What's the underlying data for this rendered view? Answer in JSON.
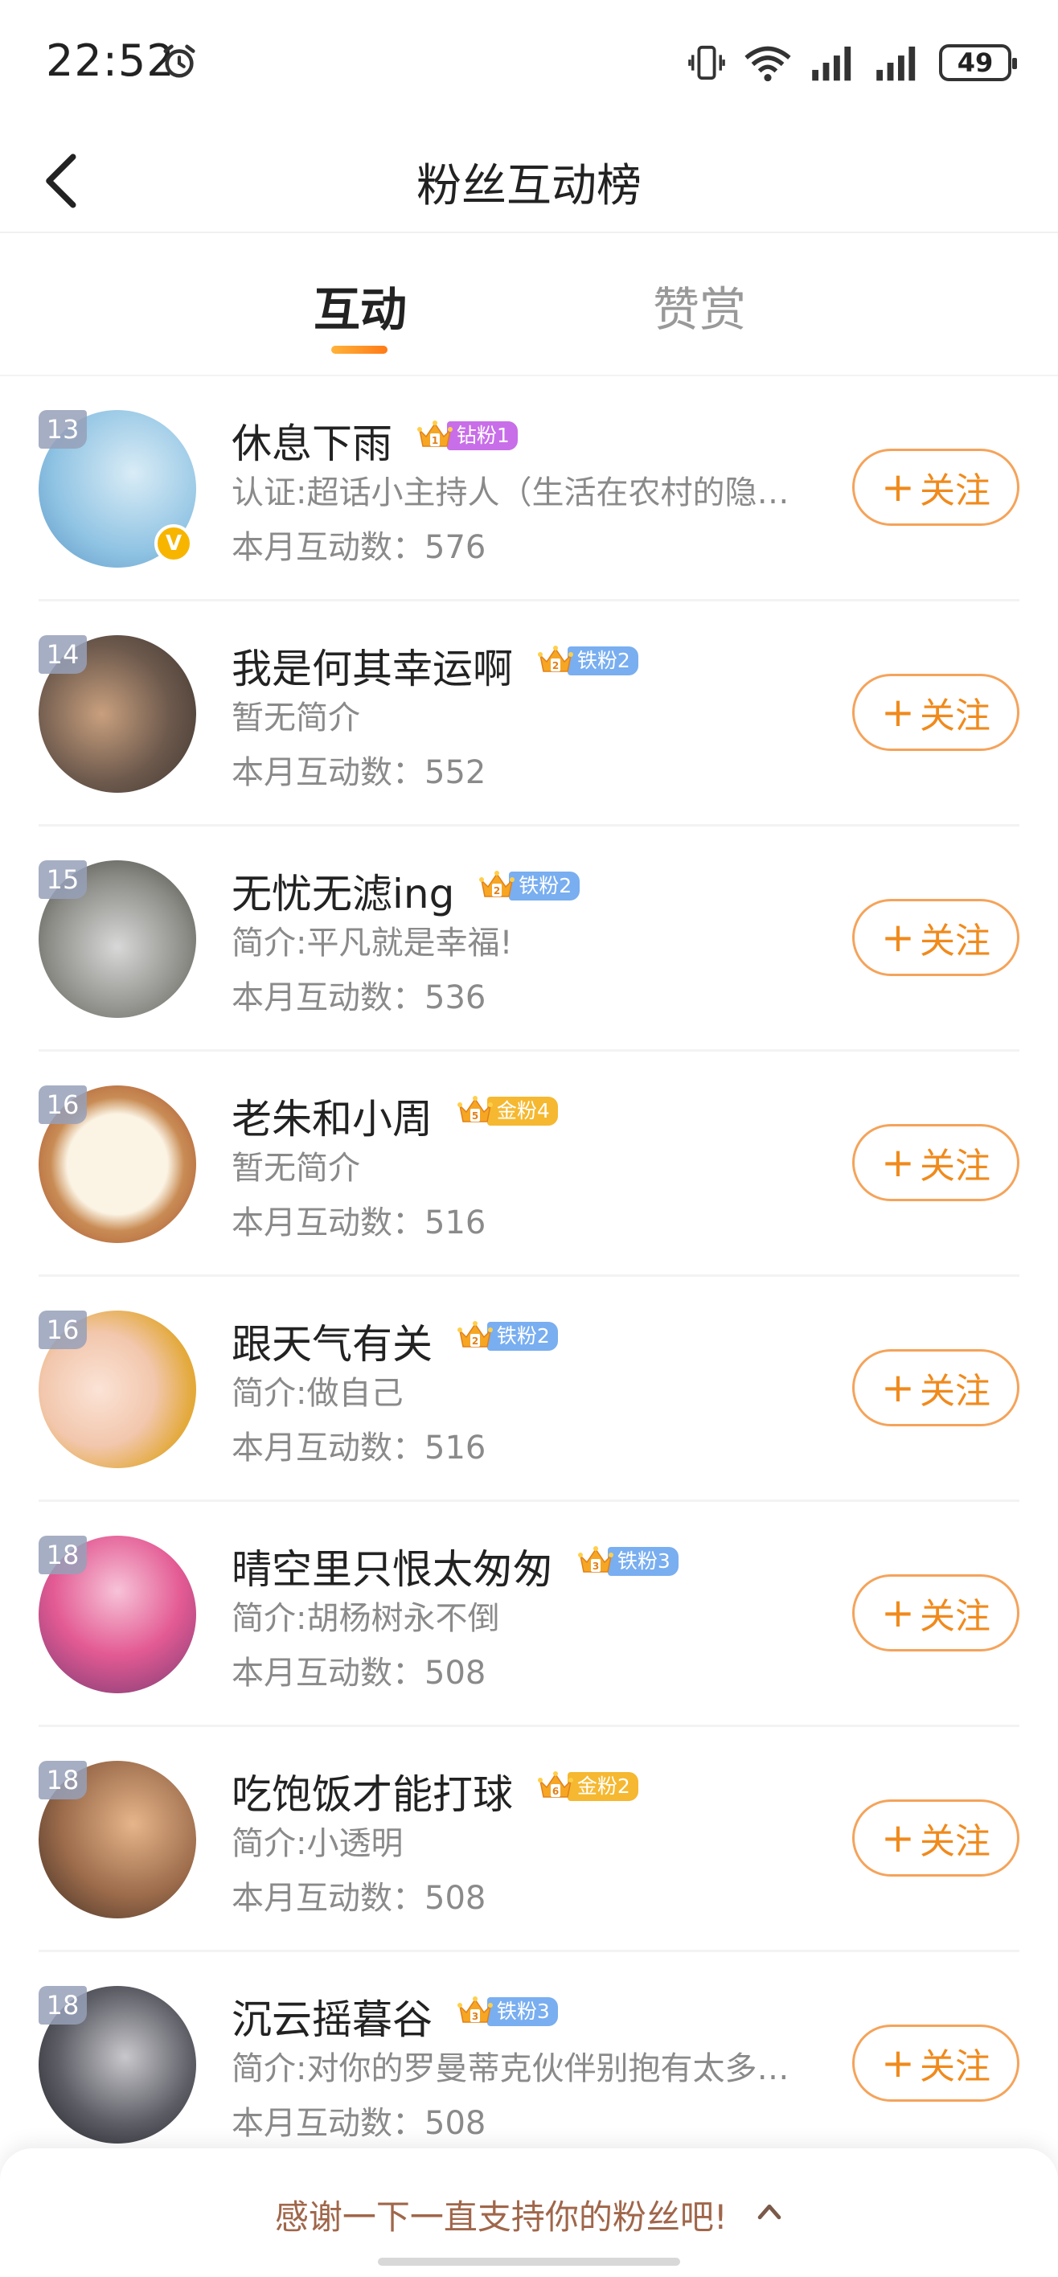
{
  "status_bar": {
    "time": "22:52",
    "battery": "49"
  },
  "header": {
    "title": "粉丝互动榜"
  },
  "tabs": [
    {
      "label": "互动",
      "active": true
    },
    {
      "label": "赞赏",
      "active": false
    }
  ],
  "list": [
    {
      "rank": "13",
      "name": "休息下雨",
      "badge": "钻粉1",
      "badge_level": "1",
      "badge_color": "#c86ee8",
      "bio": "认证:超话小主持人（生活在农村的隐…",
      "count": "本月互动数：576",
      "follow": "关注",
      "verified": true
    },
    {
      "rank": "14",
      "name": "我是何其幸运啊",
      "badge": "铁粉2",
      "badge_level": "2",
      "badge_color": "#79aef0",
      "bio": "暂无简介",
      "count": "本月互动数：552",
      "follow": "关注"
    },
    {
      "rank": "15",
      "name": "无忧无滤ing",
      "badge": "铁粉2",
      "badge_level": "2",
      "badge_color": "#79aef0",
      "bio": "简介:平凡就是幸福!",
      "count": "本月互动数：536",
      "follow": "关注"
    },
    {
      "rank": "16",
      "name": "老朱和小周",
      "badge": "金粉4",
      "badge_level": "5",
      "badge_color": "#f5b830",
      "bio": "暂无简介",
      "count": "本月互动数：516",
      "follow": "关注"
    },
    {
      "rank": "16",
      "name": "跟天气有关",
      "badge": "铁粉2",
      "badge_level": "2",
      "badge_color": "#79aef0",
      "bio": "简介:做自己",
      "count": "本月互动数：516",
      "follow": "关注"
    },
    {
      "rank": "18",
      "name": "晴空里只恨太匆匆",
      "badge": "铁粉3",
      "badge_level": "3",
      "badge_color": "#79aef0",
      "bio": "简介:胡杨树永不倒",
      "count": "本月互动数：508",
      "follow": "关注"
    },
    {
      "rank": "18",
      "name": "吃饱饭才能打球",
      "badge": "金粉2",
      "badge_level": "6",
      "badge_color": "#f5b830",
      "bio": "简介:小透明",
      "count": "本月互动数：508",
      "follow": "关注"
    },
    {
      "rank": "18",
      "name": "沉云摇暮谷",
      "badge": "铁粉3",
      "badge_level": "3",
      "badge_color": "#79aef0",
      "bio": "简介:对你的罗曼蒂克伙伴别抱有太多…",
      "count": "本月互动数：508",
      "follow": "关注"
    }
  ],
  "bottom_bar": {
    "text": "感谢一下一直支持你的粉丝吧!"
  },
  "colors": {
    "accent": "#f08a1c",
    "follow_border": "#f5a35a",
    "bottom_text": "#a0664a"
  }
}
